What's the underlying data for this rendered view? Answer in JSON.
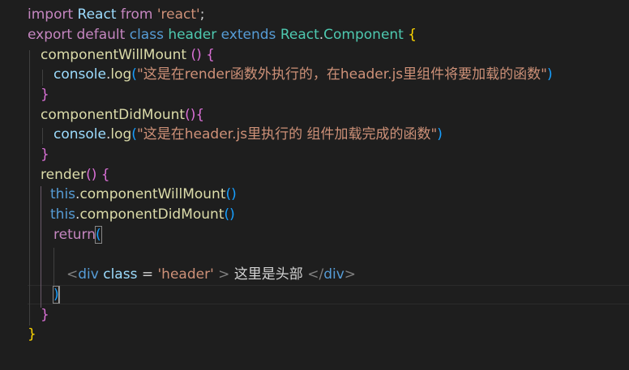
{
  "colors": {
    "background": "#1e1e1e",
    "keyword": "#c586c0",
    "storage": "#569cd6",
    "class_name": "#4ec9b0",
    "function": "#dcdcaa",
    "variable": "#9cdcfe",
    "string": "#ce9178",
    "bracket_level_1": "#ffd700",
    "bracket_level_2": "#da70d6",
    "bracket_level_3": "#179fff"
  },
  "code": {
    "l1": {
      "import": "import",
      "react": "React",
      "from": "from",
      "module": "'react'",
      "semi": ";"
    },
    "l2": {
      "export": "export",
      "default": "default",
      "class": "class",
      "name": "header",
      "extends": "extends",
      "react": "React",
      "dot": ".",
      "component": "Component",
      "brace": "{"
    },
    "l3": {
      "method": "componentWillMount",
      "paren_open": "(",
      "paren_close": ")",
      "brace": "{"
    },
    "l4": {
      "console": "console",
      "dot": ".",
      "log": "log",
      "paren_open": "(",
      "text": "\"这是在render函数外执行的，在header.js里组件将要加载的函数\"",
      "paren_close": ")"
    },
    "l5": {
      "brace": "}"
    },
    "l6": {
      "method": "componentDidMount",
      "paren_open": "(",
      "paren_close": ")",
      "brace": "{"
    },
    "l7": {
      "console": "console",
      "dot": ".",
      "log": "log",
      "paren_open": "(",
      "text": "\"这是在header.js里执行的 组件加载完成的函数\"",
      "paren_close": ")"
    },
    "l8": {
      "brace": "}"
    },
    "l9": {
      "method": "render",
      "paren_open": "(",
      "paren_close": ")",
      "brace": "{"
    },
    "l10": {
      "this": "this",
      "dot": ".",
      "call": "componentWillMount",
      "paren_open": "(",
      "paren_close": ")"
    },
    "l11": {
      "this": "this",
      "dot": ".",
      "call": "componentDidMount",
      "paren_open": "(",
      "paren_close": ")"
    },
    "l12": {
      "return": "return",
      "paren": "("
    },
    "l14": {
      "lt": "<",
      "tag": "div",
      "attr": "class",
      "eq": " = ",
      "value": "'header'",
      "gt": " > ",
      "text": "这里是头部 ",
      "close_lt": "</",
      "close_tag": "div",
      "close_gt": ">"
    },
    "l15": {
      "paren": ")"
    },
    "l16": {
      "brace": "}"
    },
    "l17": {
      "brace": "}"
    }
  }
}
